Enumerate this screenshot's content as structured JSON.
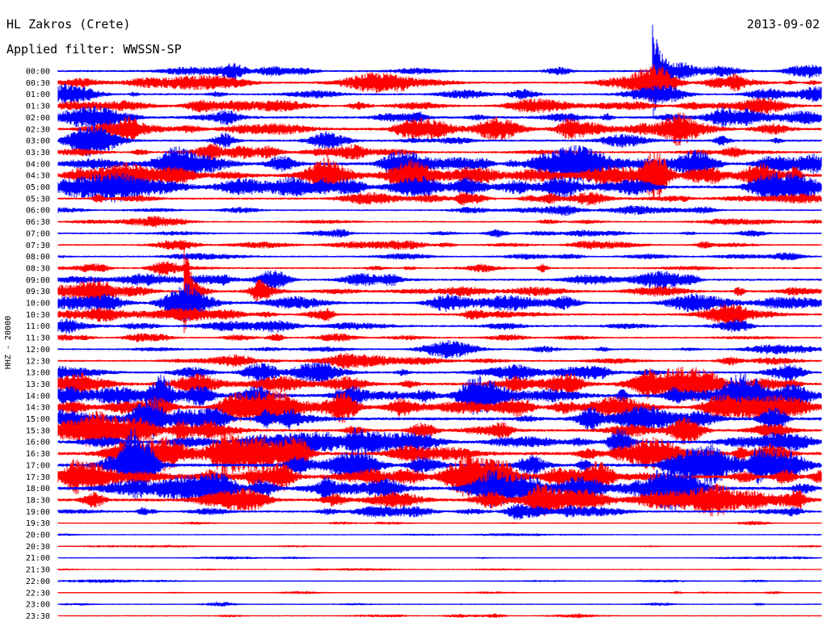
{
  "header": {
    "station": "HL Zakros (Crete)",
    "date": "2013-09-02",
    "filter": "Applied filter: WWSSN-SP"
  },
  "chart_data": {
    "type": "line",
    "title": "HL Zakros (Crete)",
    "subtitle": "Applied filter: WWSSN-SP",
    "date": "2013-09-02",
    "ylabel": "HHZ - 20000",
    "xlabel": "",
    "row_labels": [
      "00:00",
      "00:30",
      "01:00",
      "01:30",
      "02:00",
      "02:30",
      "03:00",
      "03:30",
      "04:00",
      "04:30",
      "05:00",
      "05:30",
      "06:00",
      "06:30",
      "07:00",
      "07:30",
      "08:00",
      "08:30",
      "09:00",
      "09:30",
      "10:00",
      "10:30",
      "11:00",
      "11:30",
      "12:00",
      "12:30",
      "13:00",
      "13:30",
      "14:00",
      "14:30",
      "15:00",
      "15:30",
      "16:00",
      "16:30",
      "17:00",
      "17:30",
      "18:00",
      "18:30",
      "19:00",
      "19:30",
      "20:00",
      "20:30",
      "21:00",
      "21:30",
      "22:00",
      "22:30",
      "23:00",
      "23:30"
    ],
    "trace_colors": [
      "#0000ff",
      "#ff0000"
    ],
    "row_activity": [
      0.45,
      0.5,
      0.45,
      0.5,
      0.6,
      0.7,
      0.5,
      0.45,
      0.85,
      0.9,
      0.85,
      0.5,
      0.3,
      0.3,
      0.3,
      0.3,
      0.3,
      0.35,
      0.5,
      0.55,
      0.55,
      0.5,
      0.45,
      0.35,
      0.35,
      0.4,
      0.55,
      0.75,
      0.9,
      0.9,
      0.85,
      0.7,
      0.8,
      0.9,
      0.95,
      0.95,
      0.9,
      0.8,
      0.5,
      0.1,
      0.08,
      0.08,
      0.1,
      0.08,
      0.1,
      0.1,
      0.12,
      0.12
    ],
    "events": [
      {
        "row": 0,
        "time_min": 23.4,
        "amp": 1.0
      },
      {
        "row": 19,
        "time_min": 5.0,
        "amp": 1.0
      }
    ],
    "grid": false,
    "legend": "none"
  }
}
